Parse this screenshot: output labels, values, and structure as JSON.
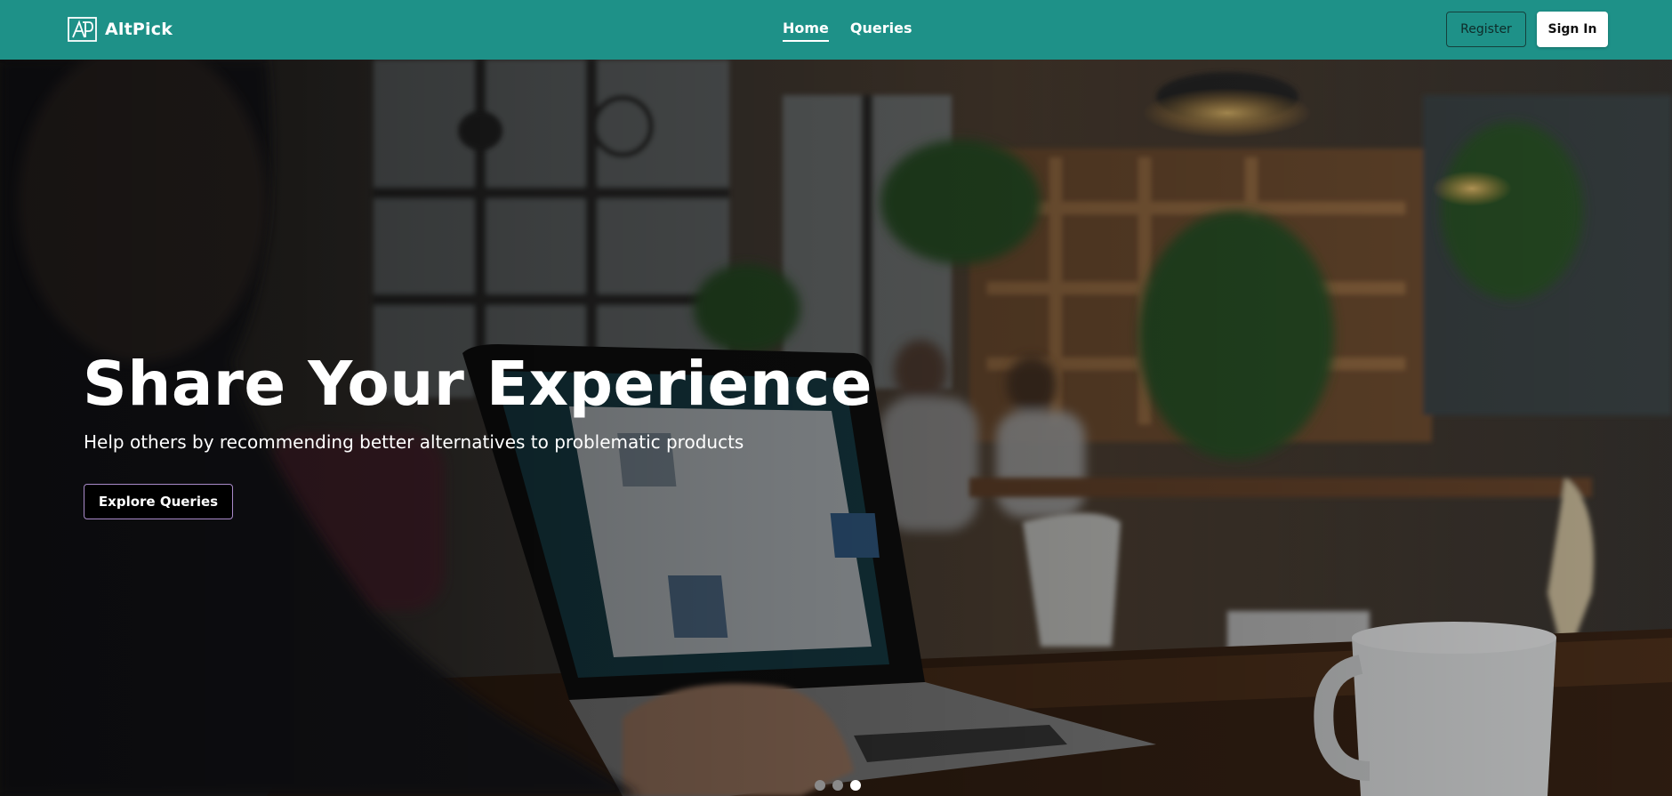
{
  "header": {
    "brand_name": "AltPick",
    "nav": [
      {
        "label": "Home",
        "active": true
      },
      {
        "label": "Queries",
        "active": false
      }
    ],
    "register_label": "Register",
    "signin_label": "Sign In",
    "colors": {
      "navbar": "#1e9188"
    }
  },
  "hero": {
    "title": "Share Your Experience",
    "subtitle": "Help others by recommending better alternatives to problematic products",
    "cta_label": "Explore Queries",
    "carousel": {
      "slide_count": 3,
      "active_index": 2
    }
  }
}
